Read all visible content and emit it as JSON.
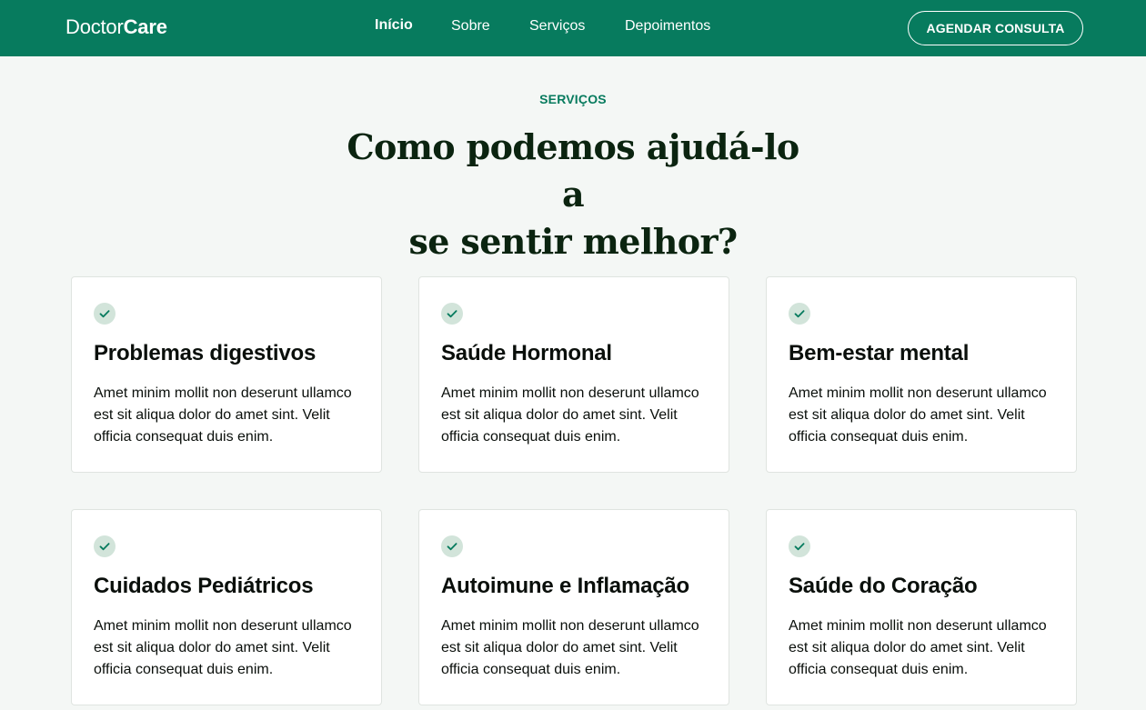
{
  "header": {
    "logo_light": "Doctor",
    "logo_bold": "Care",
    "nav": [
      "Início",
      "Sobre",
      "Serviços",
      "Depoimentos"
    ],
    "active_nav": "Início",
    "cta_label": "AGENDAR CONSULTA"
  },
  "hero": {
    "label": "SERVIÇOS",
    "title_line1": "Como podemos ajudá-lo a",
    "title_line2": "se sentir melhor?"
  },
  "services": [
    {
      "title": "Problemas digestivos",
      "text": "Amet minim mollit non deserunt ullamco est sit aliqua dolor do amet sint. Velit officia consequat duis enim.",
      "icon": "check-icon"
    },
    {
      "title": "Saúde Hormonal",
      "text": "Amet minim mollit non deserunt ullamco est sit aliqua dolor do amet sint. Velit officia consequat duis enim.",
      "icon": "check-icon"
    },
    {
      "title": "Bem-estar mental",
      "text": "Amet minim mollit non deserunt ullamco est sit aliqua dolor do amet sint. Velit officia consequat duis enim.",
      "icon": "check-icon"
    },
    {
      "title": "Cuidados Pediátricos",
      "text": "Amet minim mollit non deserunt ullamco est sit aliqua dolor do amet sint. Velit officia consequat duis enim.",
      "icon": "check-icon"
    },
    {
      "title": "Autoimune e Inflamação",
      "text": "Amet minim mollit non deserunt ullamco est sit aliqua dolor do amet sint. Velit officia consequat duis enim.",
      "icon": "check-icon"
    },
    {
      "title": "Saúde do Coração",
      "text": "Amet minim mollit non deserunt ullamco est sit aliqua dolor do amet sint. Velit officia consequat duis enim.",
      "icon": "check-icon"
    }
  ],
  "colors": {
    "brand": "#077b5e",
    "background": "#f4f7f5",
    "title": "#0b2410",
    "icon_bg": "#d2e4da"
  }
}
